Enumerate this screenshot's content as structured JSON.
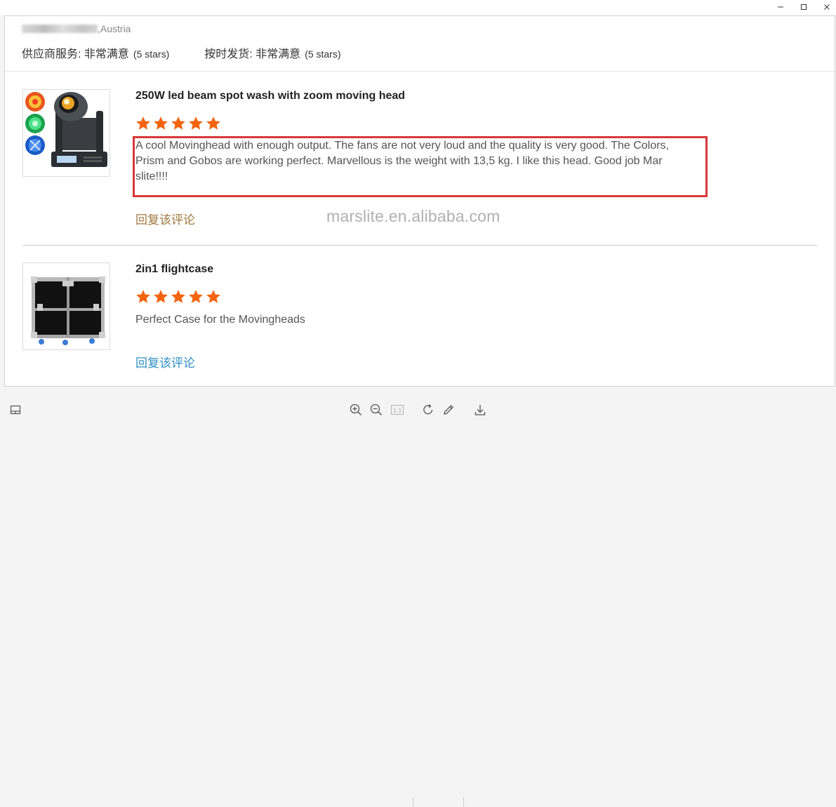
{
  "window": {
    "controls": [
      "minimize-icon",
      "maximize-icon",
      "close-icon"
    ]
  },
  "header": {
    "location": ",Austria",
    "supplier_service": "供应商服务: 非常满意",
    "supplier_service_stars": "(5 stars)",
    "on_time_shipping": "按时发货: 非常满意",
    "on_time_shipping_stars": "(5 stars)"
  },
  "reviews": [
    {
      "product_title": "250W led beam spot wash with zoom moving head",
      "rating": 5,
      "comment": "A cool Movinghead with enough output. The fans are not very loud and the quality is very good. The Colors, Prism and Gobos are working perfect. Marvellous is the weight with 13,5 kg. I like this head. Good job Mar slite!!!!",
      "comment_lines": [
        "A cool Movinghead with enough output. The fans are not very loud and the quality is very good. The Colors,",
        "Prism and Gobos are working perfect. Marvellous is the weight with 13,5 kg. I like this head. Good job Mar",
        "slite!!!!"
      ],
      "reply_label": "回复该评论",
      "reply_color": "#a0783c"
    },
    {
      "product_title": "2in1 flightcase",
      "rating": 5,
      "comment": "Perfect Case for the Movingheads",
      "reply_label": "回复该评论",
      "reply_color": "#2f8fc5"
    }
  ],
  "watermark": "marslite.en.alibaba.com",
  "colors": {
    "star": "#f3640f",
    "highlight": "#d9383a"
  },
  "toolbar": {
    "left": [
      "thumbnail-panel-icon"
    ],
    "center": [
      "zoom-in-icon",
      "zoom-out-icon",
      "actual-size-icon",
      "rotate-icon",
      "edit-icon",
      "download-icon"
    ],
    "actual_size_label": "1:1"
  }
}
